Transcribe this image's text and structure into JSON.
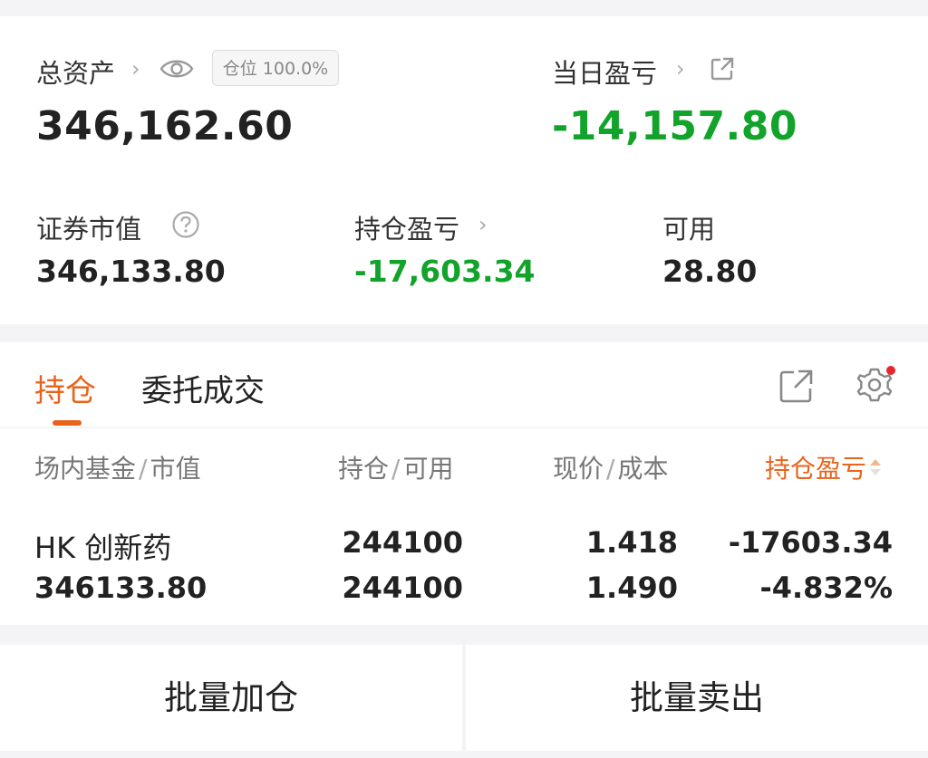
{
  "summary": {
    "total_assets_label": "总资产",
    "position_badge": "仓位 100.0%",
    "total_assets_value": "346,162.60",
    "daily_pl_label": "当日盈亏",
    "daily_pl_value": "-14,157.80",
    "securities_value_label": "证券市值",
    "securities_value": "346,133.80",
    "holding_pl_label": "持仓盈亏",
    "holding_pl_value": "-17,603.34",
    "available_label": "可用",
    "available_value": "28.80"
  },
  "tabs": [
    {
      "label": "持仓",
      "active": true
    },
    {
      "label": "委托成交",
      "active": false
    }
  ],
  "table": {
    "headers": [
      {
        "main": "场内基金",
        "sub": "市值"
      },
      {
        "main": "持仓",
        "sub": "可用"
      },
      {
        "main": "现价",
        "sub": "成本"
      },
      {
        "main": "持仓盈亏",
        "sub": ""
      }
    ],
    "rows": [
      {
        "name": "HK 创新药",
        "market_value": "346133.80",
        "holding": "244100",
        "available": "244100",
        "price": "1.418",
        "cost": "1.490",
        "pl": "-17603.34",
        "pl_pct": "-4.832%"
      }
    ]
  },
  "actions": {
    "batch_add_label": "批量加仓",
    "batch_sell_label": "批量卖出"
  },
  "colors": {
    "accent": "#e8641c",
    "loss": "#12a32b",
    "notification_dot": "#e8262b"
  },
  "icons": [
    "chevron-right-icon",
    "eye-icon",
    "external-link-icon",
    "help-circle-icon",
    "share-icon",
    "gear-icon",
    "sort-icon"
  ]
}
